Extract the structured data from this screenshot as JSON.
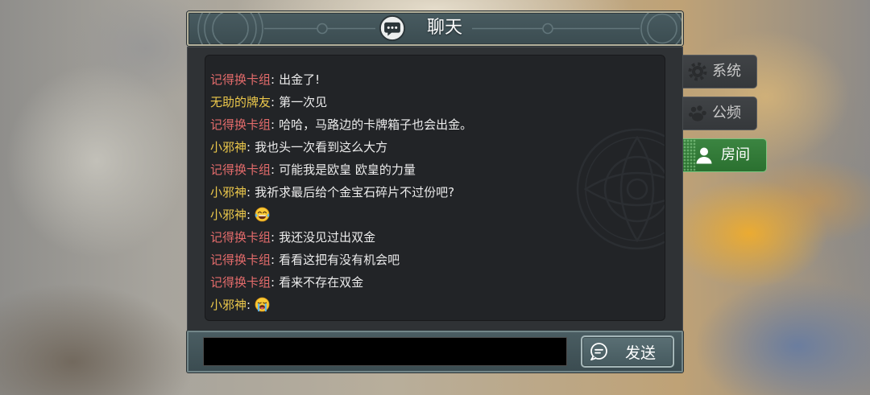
{
  "header": {
    "title": "聊天",
    "icon": "chat-bubble-icon"
  },
  "tabs": [
    {
      "label": "系统",
      "icon": "gear-icon",
      "selected": false
    },
    {
      "label": "公频",
      "icon": "group-icon",
      "selected": false
    },
    {
      "label": "房间",
      "icon": "person-icon",
      "selected": true
    }
  ],
  "chat": {
    "separator": ":",
    "messages": [
      {
        "sender": "记得换卡组",
        "sender_color": "#e36b6b",
        "text": "出金了!"
      },
      {
        "sender": "无助的牌友",
        "sender_color": "#ecc84b",
        "text": "第一次见"
      },
      {
        "sender": "记得换卡组",
        "sender_color": "#e36b6b",
        "text": "哈哈，马路边的卡牌箱子也会出金。"
      },
      {
        "sender": "小邪神",
        "sender_color": "#ecc84b",
        "text": "我也头一次看到这么大方"
      },
      {
        "sender": "记得换卡组",
        "sender_color": "#e36b6b",
        "text": "可能我是欧皇 欧皇的力量"
      },
      {
        "sender": "小邪神",
        "sender_color": "#ecc84b",
        "text": "我祈求最后给个金宝石碎片不过份吧?"
      },
      {
        "sender": "小邪神",
        "sender_color": "#ecc84b",
        "emoji": "tears-of-joy-emoji-icon"
      },
      {
        "sender": "记得换卡组",
        "sender_color": "#e36b6b",
        "text": "我还没见过出双金"
      },
      {
        "sender": "记得换卡组",
        "sender_color": "#e36b6b",
        "text": "看看这把有没有机会吧"
      },
      {
        "sender": "记得换卡组",
        "sender_color": "#e36b6b",
        "text": "看来不存在双金"
      },
      {
        "sender": "小邪神",
        "sender_color": "#ecc84b",
        "emoji": "loudly-crying-emoji-icon"
      }
    ]
  },
  "input": {
    "value": ""
  },
  "send_button": {
    "label": "发送",
    "icon": "chat-bubble-icon"
  },
  "colors": {
    "selected_tab": "#2f7d35"
  }
}
